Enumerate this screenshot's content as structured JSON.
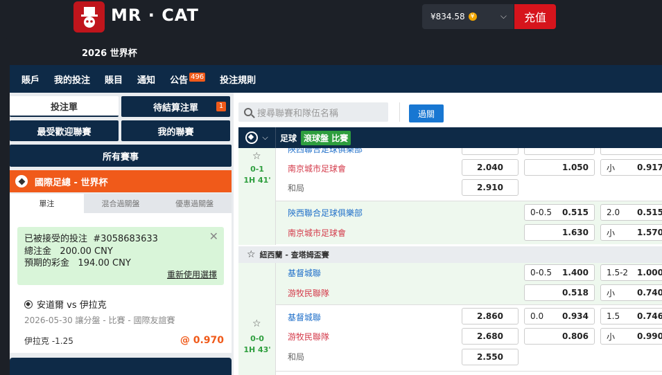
{
  "header": {
    "brand": "MR · CAT",
    "subtitle": "2026 世界杯",
    "balance": "¥834.58",
    "coin_symbol": "¥",
    "recharge_label": "充值"
  },
  "nav": {
    "items": [
      {
        "label": "賬戶"
      },
      {
        "label": "我的投注"
      },
      {
        "label": "賬目"
      },
      {
        "label": "通知"
      },
      {
        "label": "公告",
        "badge": "496"
      },
      {
        "label": "投注規則"
      }
    ]
  },
  "sidebar": {
    "bet_slip_label": "投注單",
    "pending_label": "待結算注單",
    "pending_count": "1",
    "popular_label": "最受歡迎聯賽",
    "my_leagues_label": "我的聯賽",
    "all_events_label": "所有賽事",
    "league_title": "國際足總 - 世界杯",
    "tabs": [
      "單注",
      "混合過關盤",
      "優惠過關盤"
    ],
    "accepted": {
      "line1_label": "已被接受的投注",
      "bet_id": "#3058683633",
      "line2_label": "總注金",
      "stake": "200.00 CNY",
      "line3_label": "預期的彩金",
      "payout": "194.00 CNY",
      "reuse_label": "重新使用選擇"
    },
    "bet": {
      "match": "安道爾 vs 伊拉克",
      "info": "2026-05-30 讓分盤 - 比賽  - 國際友誼賽",
      "selection": "伊拉克 -1.25",
      "odds": "@ 0.970"
    }
  },
  "main": {
    "search_placeholder": "搜尋聯賽和隊伍名稱",
    "parlay_label": "過關",
    "sport_label": "足球",
    "live_label": "滾球盤 比賽",
    "match1": {
      "partial_team": "陝西聯合足球俱樂部",
      "score": "0-1",
      "time": "1H 41'",
      "home": "南京城市足球會",
      "draw": "和局",
      "odds_1x2_home": "2.040",
      "odds_1x2_draw": "2.910",
      "hdp_away_odds": "1.050",
      "ou_under_label": "小",
      "ou_under_odds": "0.917",
      "row2_team1": "陝西聯合足球俱樂部",
      "row2_team2": "南京城市足球會",
      "row2_hdp_line": "0-0.5",
      "row2_hdp_odds": "0.515",
      "row2_hdp_odds2": "1.630",
      "row2_ou_line": "2.0",
      "row2_ou_odds": "0.515",
      "row2_ou_under_label": "小",
      "row2_ou_under_odds": "1.570"
    },
    "league2": "紐西蘭 - 查塔姆盃賽",
    "match2": {
      "team1": "基督城聯",
      "team2": "游牧民聯隊",
      "hdp_line": "0-0.5",
      "hdp_odds1": "1.400",
      "hdp_odds2": "0.518",
      "ou_line": "1.5-2",
      "ou_odds1": "1.000",
      "ou_under_label": "小",
      "ou_odds2": "0.740"
    },
    "match3": {
      "score": "0-0",
      "time": "1H 43'",
      "team1": "基督城聯",
      "team2": "游牧民聯隊",
      "draw": "和局",
      "odds_home": "2.860",
      "odds_away": "2.680",
      "odds_draw": "2.550",
      "hdp_line": "0.0",
      "hdp_odds1": "0.934",
      "hdp_odds2": "0.806",
      "ou_line": "1.5",
      "ou_odds1": "0.746",
      "ou_under_label": "小",
      "ou_odds2": "0.990"
    }
  }
}
